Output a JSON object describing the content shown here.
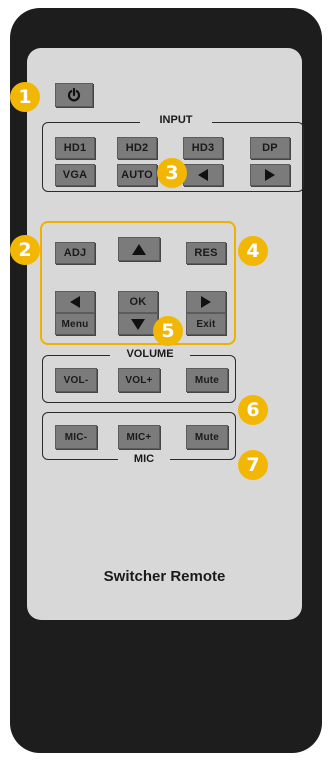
{
  "power": {
    "icon": "power-icon"
  },
  "input": {
    "label": "INPUT",
    "buttons": [
      "HD1",
      "HD2",
      "HD3",
      "DP",
      "VGA",
      "AUTO"
    ],
    "arrows": [
      "arrow-left-icon",
      "arrow-right-icon"
    ]
  },
  "adj": "ADJ",
  "res": "RES",
  "nav": {
    "ok": "OK",
    "menu": "Menu",
    "exit": "Exit",
    "arrows": [
      "arrow-up-icon",
      "arrow-left-icon",
      "arrow-right-icon",
      "arrow-down-icon"
    ]
  },
  "volume": {
    "label": "VOLUME",
    "buttons": [
      "VOL-",
      "VOL+",
      "Mute"
    ]
  },
  "mic": {
    "label": "MIC",
    "buttons": [
      "MIC-",
      "MIC+",
      "Mute"
    ]
  },
  "badges": [
    "1",
    "2",
    "3",
    "4",
    "5",
    "6",
    "7"
  ],
  "title": "Switcher Remote",
  "colors": {
    "body": "#1d1d1d",
    "panel": "#d8d8d8",
    "button": "#7b7b7b",
    "badge": "#f2b705",
    "highlight": "#f0b000"
  }
}
